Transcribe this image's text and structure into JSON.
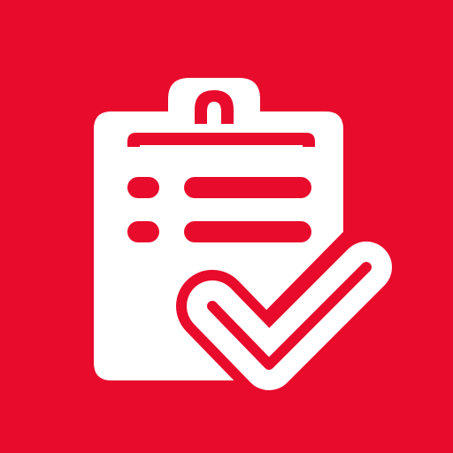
{
  "app_icon": {
    "icon_name": "clipboard-checklist-icon",
    "colors": {
      "background": "#E80B2C",
      "foreground": "#FFFFFF"
    }
  }
}
